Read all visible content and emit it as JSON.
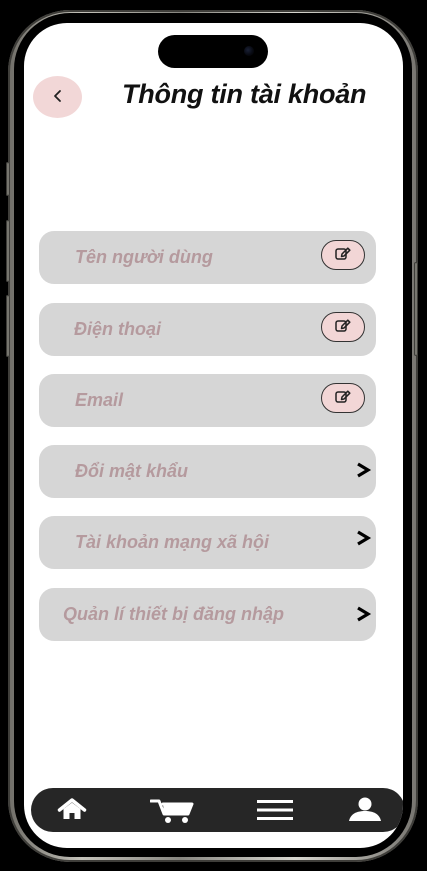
{
  "header": {
    "back_icon": "chevron-left-icon",
    "title": "Thông tin tài khoản"
  },
  "account_items": [
    {
      "label": "Tên người dùng",
      "action_icon": "edit-icon"
    },
    {
      "label": "Điện thoại",
      "action_icon": "edit-icon"
    },
    {
      "label": "Email",
      "action_icon": "edit-icon"
    },
    {
      "label": "Đổi mật khẩu",
      "action_icon": "chevron-right-icon"
    },
    {
      "label": "Tài khoản mạng xã hội",
      "action_icon": "chevron-right-icon"
    },
    {
      "label": "Quản lí thiết bị đăng nhập",
      "action_icon": "chevron-right-icon"
    }
  ],
  "bottom_nav": [
    {
      "icon": "home-icon"
    },
    {
      "icon": "cart-icon"
    },
    {
      "icon": "menu-icon"
    },
    {
      "icon": "user-icon"
    }
  ],
  "colors": {
    "screen_background": "#ffffff",
    "item_background": "#d6d6d6",
    "item_text": "#b59a9e",
    "accent_pink": "#f2d6d6",
    "title_text": "#111111",
    "nav_background": "#262626",
    "nav_icon": "#ffffff"
  }
}
